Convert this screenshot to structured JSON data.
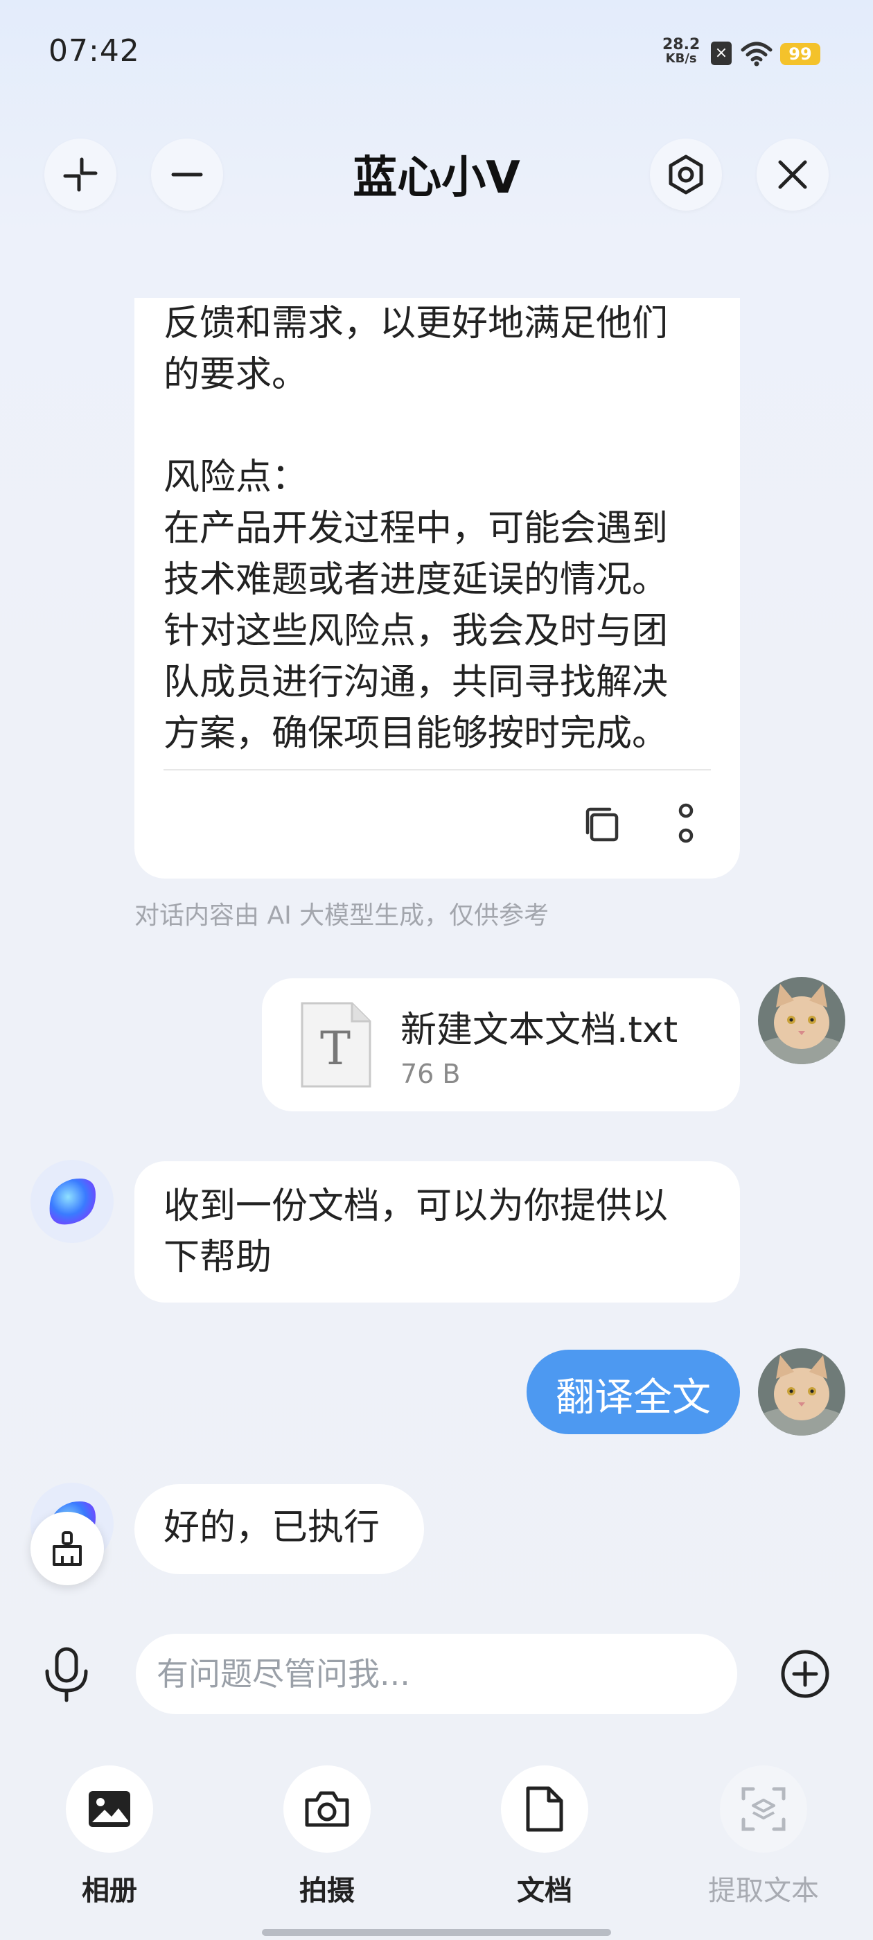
{
  "status_bar": {
    "time": "07:42",
    "net_speed_value": "28.2",
    "net_speed_unit": "KB/s",
    "battery": "99"
  },
  "header": {
    "title": "蓝心小V"
  },
  "chat": {
    "long_reply_text": "反馈和需求，以更好地满足他们\n的要求。\n\n风险点：\n在产品开发过程中，可能会遇到\n技术难题或者进度延误的情况。\n针对这些风险点，我会及时与团\n队成员进行沟通，共同寻找解决\n方案，确保项目能够按时完成。",
    "disclaimer": "对话内容由 AI 大模型生成，仅供参考",
    "file_name": "新建文本文档.txt",
    "file_size": "76 B",
    "file_type_letter": "T",
    "ai_reply_1": "收到一份文档，可以为你提供以\n下帮助",
    "user_message": "翻译全文",
    "ai_reply_2": "好的，已执行"
  },
  "input": {
    "placeholder": "有问题尽管问我..."
  },
  "tools": [
    {
      "label": "相册",
      "icon": "image-icon"
    },
    {
      "label": "拍摄",
      "icon": "camera-icon"
    },
    {
      "label": "文档",
      "icon": "document-icon"
    },
    {
      "label": "提取文本",
      "icon": "scan-text-icon"
    }
  ],
  "colors": {
    "accent_blue": "#4d99f1",
    "battery_yellow": "#f4c22b",
    "bubble_white": "#ffffff"
  }
}
